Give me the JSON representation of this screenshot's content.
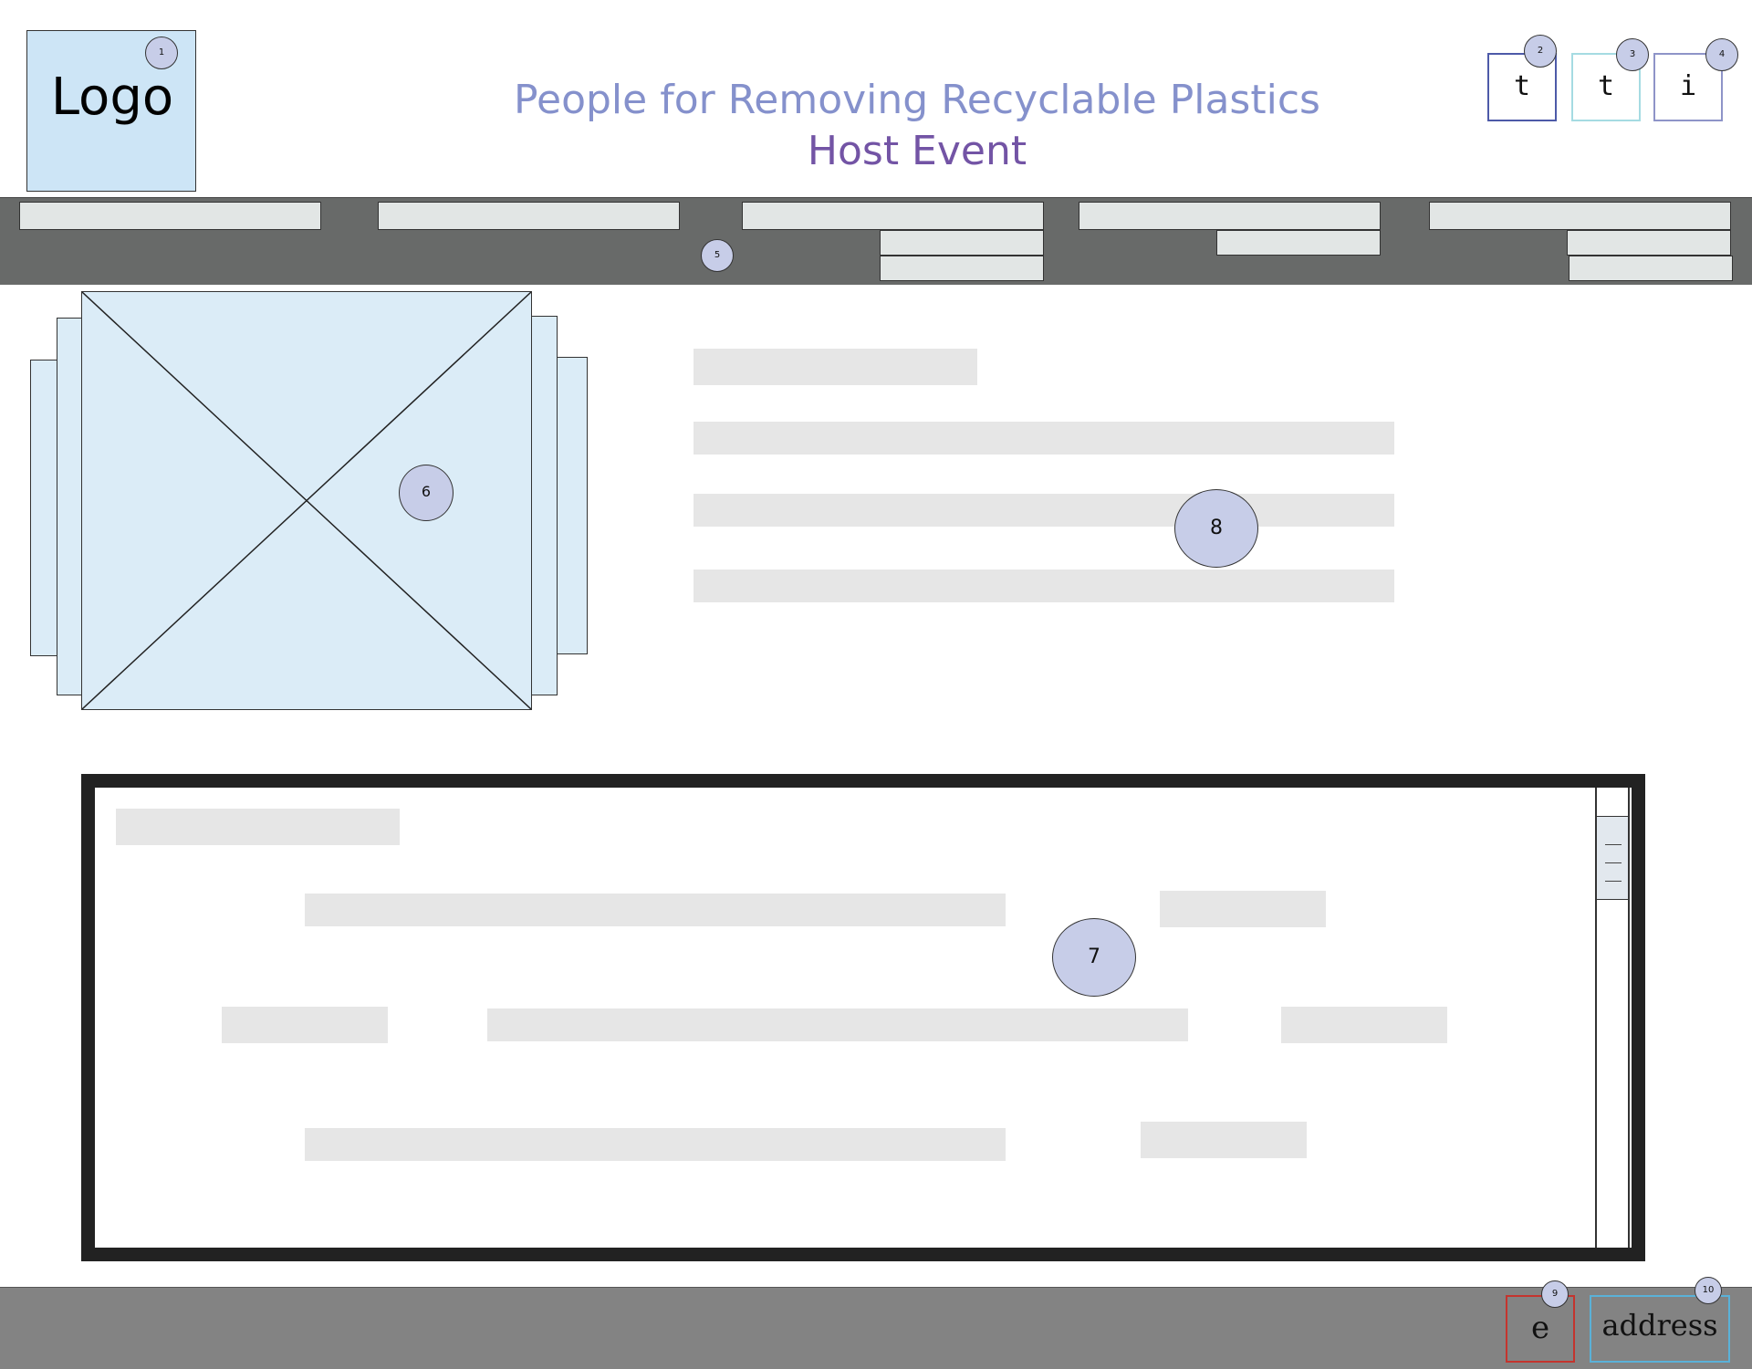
{
  "header": {
    "logo_label": "Logo",
    "title": "People for Removing Recyclable Plastics",
    "subtitle": "Host Event",
    "social_buttons": [
      "t",
      "t",
      "i"
    ]
  },
  "footer": {
    "email_label": "e",
    "address_label": "address"
  },
  "callouts": [
    "1",
    "2",
    "3",
    "4",
    "5",
    "6",
    "7",
    "8",
    "9",
    "10"
  ],
  "colors": {
    "title": "#8591cc",
    "subtitle": "#7354a5",
    "navbar": "#686a69",
    "footer": "#838383",
    "image_placeholder": "#dbecf7",
    "badge": "#c7cde8"
  }
}
